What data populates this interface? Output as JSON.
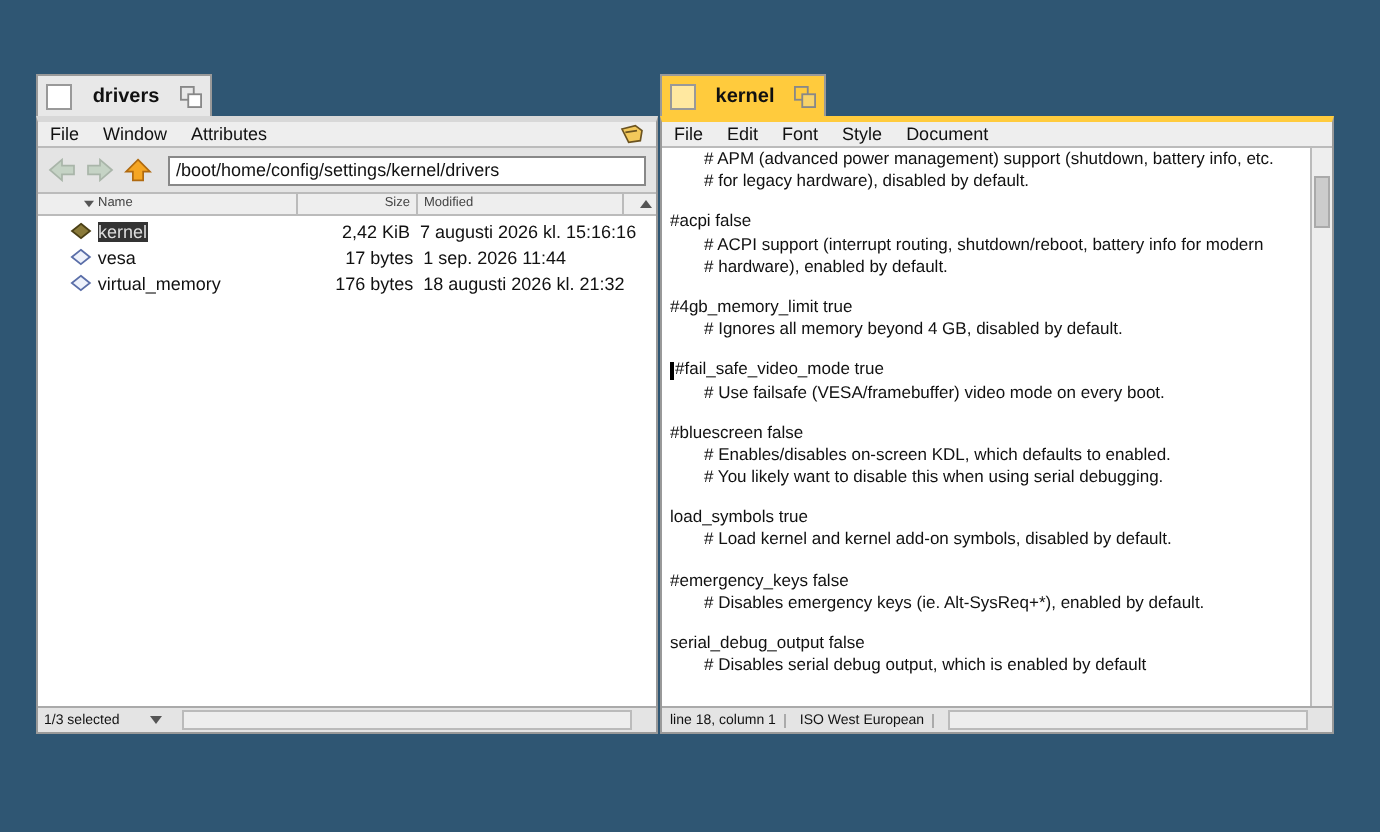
{
  "windows": [
    {
      "kind": "tracker",
      "title": "drivers",
      "active": false,
      "menu": [
        "File",
        "Window",
        "Attributes"
      ],
      "path": "/boot/home/config/settings/kernel/drivers",
      "columns": [
        "Name",
        "Size",
        "Modified"
      ],
      "rows": [
        {
          "name": "kernel",
          "size": "2,42 KiB",
          "modified": "7 augusti 2026 kl. 15:16:16",
          "kind": "package",
          "selected": true
        },
        {
          "name": "vesa",
          "size": "17 bytes",
          "modified": "1 sep. 2026 11:44",
          "kind": "file",
          "selected": false
        },
        {
          "name": "virtual_memory",
          "size": "176 bytes",
          "modified": "18 augusti 2026 kl. 21:32",
          "kind": "file",
          "selected": false
        }
      ],
      "status": "1/3 selected"
    },
    {
      "kind": "editor",
      "title": "kernel",
      "active": true,
      "menu": [
        "File",
        "Edit",
        "Font",
        "Style",
        "Document"
      ],
      "entries": [
        {
          "comments": [
            "# APM (advanced power management) support (shutdown, battery info, etc.",
            "# for legacy hardware), disabled by default."
          ]
        },
        {
          "setting": "#acpi false",
          "comments": [
            "# ACPI support (interrupt routing, shutdown/reboot, battery info for modern",
            "# hardware), enabled by default."
          ]
        },
        {
          "setting": "#4gb_memory_limit true",
          "comments": [
            "# Ignores all memory beyond 4 GB, disabled by default."
          ]
        },
        {
          "setting": "#fail_safe_video_mode true",
          "caret": true,
          "comments": [
            "# Use failsafe (VESA/framebuffer) video mode on every boot."
          ]
        },
        {
          "setting": "#bluescreen false",
          "comments": [
            "# Enables/disables on-screen KDL, which defaults to enabled.",
            "# You likely want to disable this when using serial debugging."
          ]
        },
        {
          "setting": "load_symbols true",
          "comments": [
            "# Load kernel and kernel add-on symbols, disabled by default."
          ]
        },
        {
          "setting": "#emergency_keys false",
          "comments": [
            "# Disables emergency keys (ie. Alt-SysReq+*), enabled by default."
          ]
        },
        {
          "setting": "serial_debug_output false",
          "comments": [
            "# Disables serial debug output, which is enabled by default"
          ]
        }
      ],
      "status": [
        "line 18, column 1",
        "ISO West European"
      ]
    }
  ]
}
